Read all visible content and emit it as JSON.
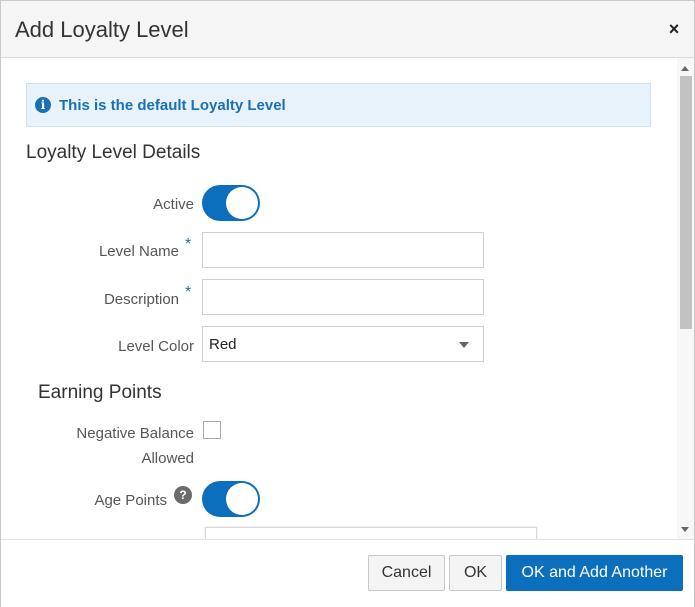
{
  "dialog": {
    "title": "Add Loyalty Level",
    "close_symbol": "×"
  },
  "info_banner": {
    "icon": "info-icon",
    "icon_glyph": "i",
    "text": "This is the default Loyalty Level"
  },
  "details_section": {
    "title": "Loyalty Level Details",
    "active_label": "Active",
    "active_value": true,
    "level_name_label": "Level Name",
    "level_name_value": "",
    "description_label": "Description",
    "description_value": "",
    "required_marker": "*",
    "level_color_label": "Level Color",
    "level_color_value": "Red"
  },
  "earning_section": {
    "title": "Earning Points",
    "negative_balance_label_line1": "Negative Balance",
    "negative_balance_label_line2": "Allowed",
    "negative_balance_checked": false,
    "age_points_label": "Age Points",
    "help_glyph": "?",
    "age_points_value": true
  },
  "footer": {
    "cancel_label": "Cancel",
    "ok_label": "OK",
    "ok_add_label": "OK and Add Another"
  },
  "colors": {
    "accent": "#0c6fbd",
    "banner_bg": "#e8f2fa",
    "banner_text": "#1a6fb5"
  }
}
